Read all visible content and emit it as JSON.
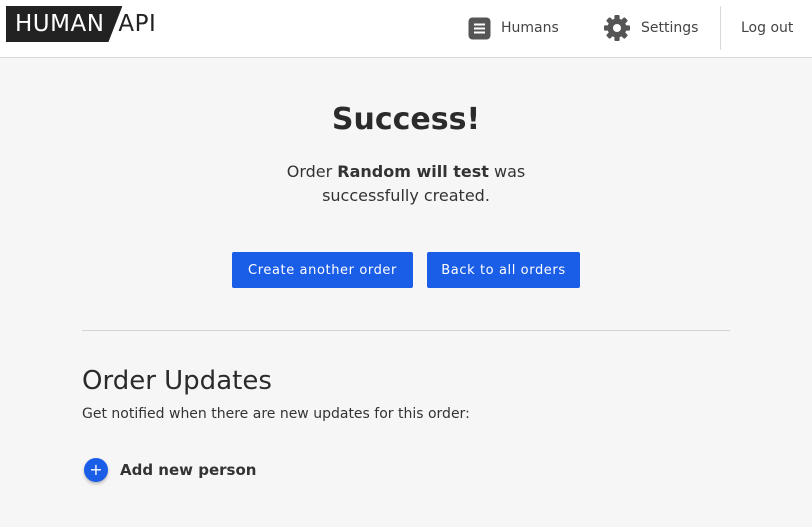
{
  "header": {
    "logo": {
      "part1": "HUMAN",
      "part2": "API"
    },
    "nav": {
      "humans_label": "Humans",
      "humans_icon": "list-icon",
      "settings_label": "Settings",
      "settings_icon": "gear-icon",
      "logout_label": "Log out"
    }
  },
  "main": {
    "title": "Success!",
    "message_prefix": "Order ",
    "order_name": "Random will test",
    "message_suffix": " was successfully created.",
    "buttons": {
      "create_another": "Create another order",
      "back_to_orders": "Back to all orders"
    }
  },
  "updates": {
    "title": "Order Updates",
    "subtitle": "Get notified when there are new updates for this order:",
    "add_label": "Add new person",
    "add_icon": "plus-icon"
  },
  "colors": {
    "accent": "#1a5de6",
    "logo_bg": "#222222"
  }
}
